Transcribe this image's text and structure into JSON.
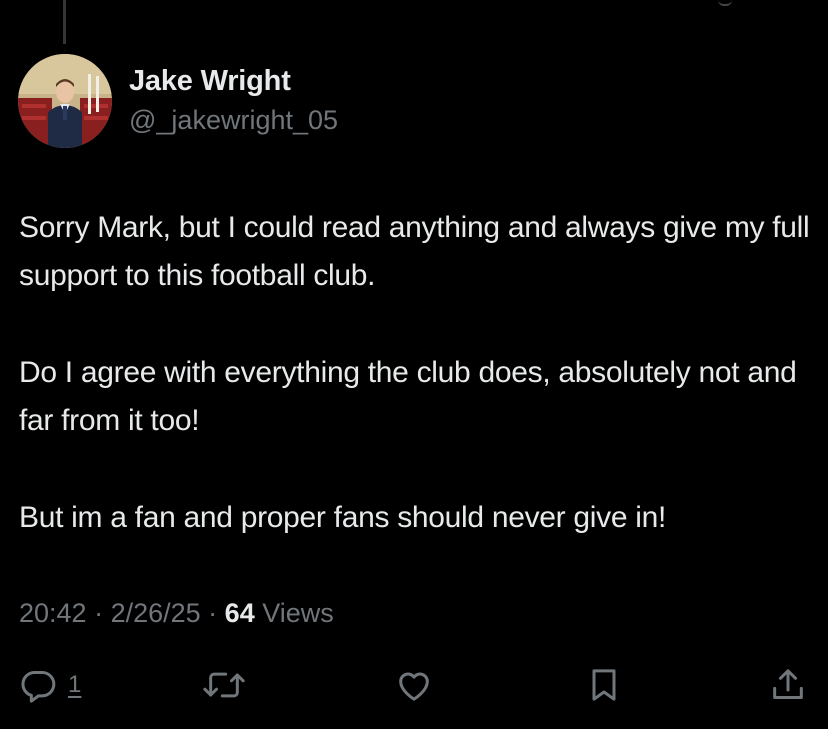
{
  "tweet": {
    "author": {
      "display_name": "Jake Wright",
      "handle": "@_jakewright_05"
    },
    "paragraphs": [
      "Sorry Mark, but I could read anything and always give my full support to this football club.",
      "Do I agree with everything the club does, absolutely not and far from it too!",
      "But im a fan and proper fans should never give in!"
    ],
    "time": "20:42",
    "separator": " · ",
    "date": "2/26/25",
    "views_count": "64",
    "views_label": "Views"
  },
  "actions": {
    "reply_count": "1",
    "icons": [
      "reply-icon",
      "retweet-icon",
      "like-icon",
      "bookmark-icon",
      "share-icon"
    ]
  },
  "colors": {
    "background": "#000000",
    "text_primary": "#e7e9ea",
    "text_secondary": "#71767b"
  }
}
